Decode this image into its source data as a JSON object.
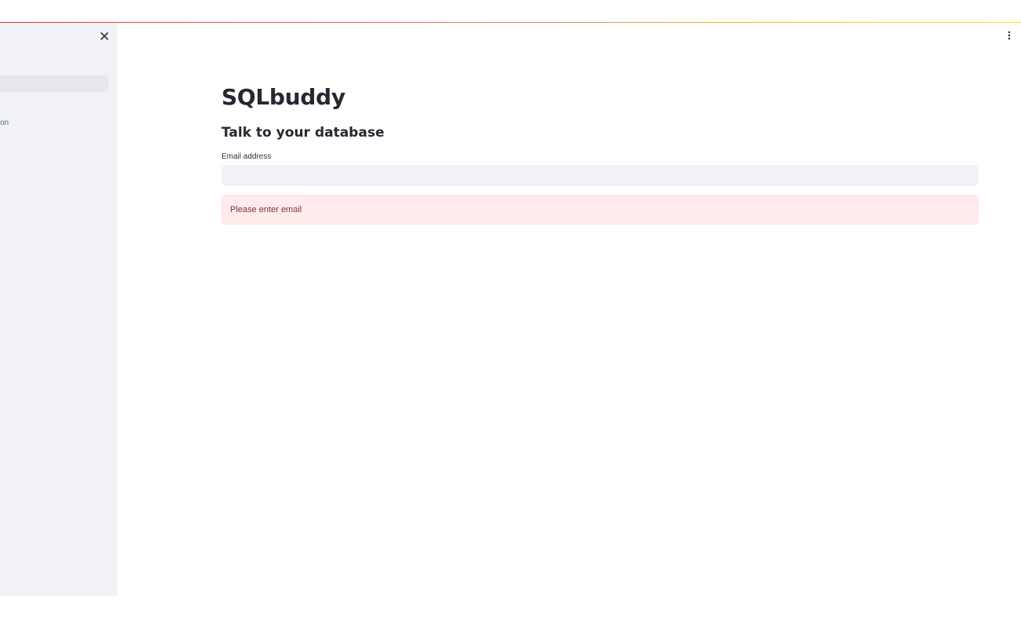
{
  "app": {
    "accent_gradient": [
      "#ff2b2b",
      "#ff8a3d",
      "#ffe312"
    ]
  },
  "sidebar": {
    "close_icon": "close-icon",
    "nav_items": [
      {
        "label": "",
        "active": true
      },
      {
        "label": "on",
        "active": false
      }
    ]
  },
  "header": {
    "menu_icon": "more-vertical-icon"
  },
  "main": {
    "title": "SQLbuddy",
    "subtitle": "Talk to your database",
    "email_label": "Email address",
    "email_value": "",
    "email_placeholder": "",
    "error_message": "Please enter email",
    "error_color": "#ffebeb"
  }
}
